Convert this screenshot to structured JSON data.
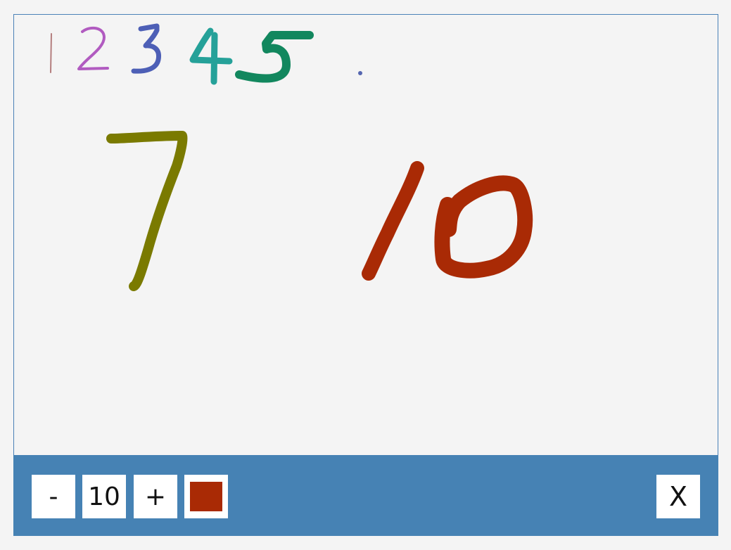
{
  "toolbar": {
    "decrease_label": "-",
    "brush_size": "10",
    "increase_label": "+",
    "current_color": "#a92a05",
    "close_label": "X",
    "background_color": "#4682b4"
  },
  "canvas": {
    "background_color": "#f4f4f4",
    "strokes": [
      {
        "label": "1",
        "color": "#b47e7e"
      },
      {
        "label": "2",
        "color": "#b15bc0"
      },
      {
        "label": "3",
        "color": "#4d5fb6"
      },
      {
        "label": "4",
        "color": "#25a199"
      },
      {
        "label": "5",
        "color": "#12875e"
      },
      {
        "label": ".",
        "color": "#5566b0"
      },
      {
        "label": "7",
        "color": "#7a7a00"
      },
      {
        "label": "10",
        "color": "#a92a05"
      }
    ]
  }
}
